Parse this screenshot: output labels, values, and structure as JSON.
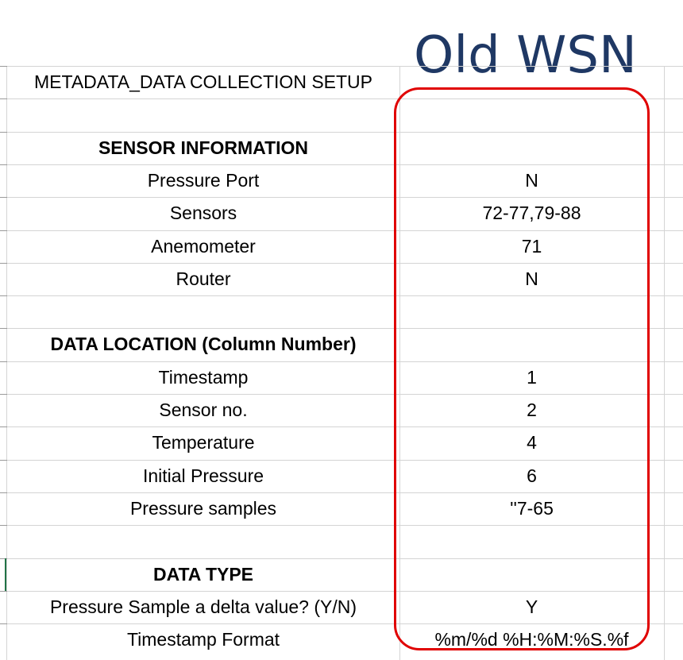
{
  "annotation": {
    "title": "Old WSN",
    "title_color": "#1f3864",
    "box_color": "#e00000"
  },
  "sheet": {
    "rows": [
      {
        "label": "METADATA_DATA COLLECTION SETUP",
        "value": "",
        "style": "title"
      },
      {
        "label": "",
        "value": "",
        "style": "blank"
      },
      {
        "label": "SENSOR INFORMATION",
        "value": "",
        "style": "header"
      },
      {
        "label": "Pressure Port",
        "value": "N",
        "style": "item"
      },
      {
        "label": "Sensors",
        "value": "72-77,79-88",
        "style": "item"
      },
      {
        "label": "Anemometer",
        "value": "71",
        "style": "item"
      },
      {
        "label": "Router",
        "value": "N",
        "style": "item"
      },
      {
        "label": "",
        "value": "",
        "style": "blank"
      },
      {
        "label": "DATA LOCATION (Column Number)",
        "value": "",
        "style": "header"
      },
      {
        "label": "Timestamp",
        "value": "1",
        "style": "item"
      },
      {
        "label": "Sensor no.",
        "value": "2",
        "style": "item"
      },
      {
        "label": "Temperature",
        "value": "4",
        "style": "item"
      },
      {
        "label": "Initial Pressure",
        "value": "6",
        "style": "item"
      },
      {
        "label": "Pressure samples",
        "value": "''7-65",
        "style": "item"
      },
      {
        "label": "",
        "value": "",
        "style": "blank"
      },
      {
        "label": "DATA TYPE",
        "value": "",
        "style": "header"
      },
      {
        "label": "Pressure Sample a delta value? (Y/N)",
        "value": "Y",
        "style": "item"
      },
      {
        "label": "Timestamp Format",
        "value": "%m/%d %H:%M:%S.%f",
        "style": "item"
      }
    ]
  }
}
